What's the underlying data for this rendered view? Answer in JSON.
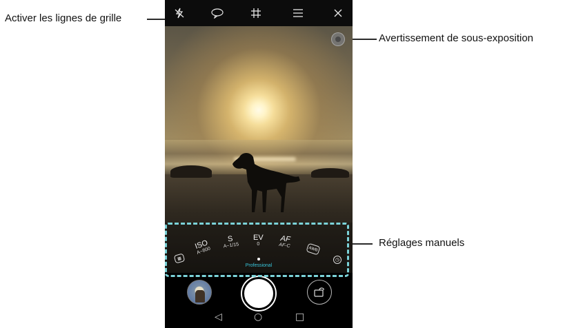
{
  "callouts": {
    "grid_lines": "Activer les lignes de grille",
    "underexposure": "Avertissement de sous-exposition",
    "manual_settings": "Réglages manuels"
  },
  "topbar": {
    "icons": [
      "flash-off-icon",
      "speech-bubble-icon",
      "grid-icon",
      "menu-icon",
      "close-icon"
    ],
    "flash": "⚡",
    "bubble": "",
    "grid": "#",
    "menu": "≡",
    "close": "✕"
  },
  "manual": {
    "iso": {
      "name": "ISO",
      "value": "A~800"
    },
    "s": {
      "name": "S",
      "value": "A~1/15"
    },
    "ev": {
      "name": "EV",
      "value": "0"
    },
    "af": {
      "name": "AF",
      "value": "AF-C"
    },
    "awb": "AWB",
    "mode": "Professional"
  },
  "nav": {
    "back": "◁",
    "home": "○",
    "recent": "□"
  },
  "colors": {
    "accent": "#7bd3d9",
    "mode_label": "#39c6dd"
  }
}
